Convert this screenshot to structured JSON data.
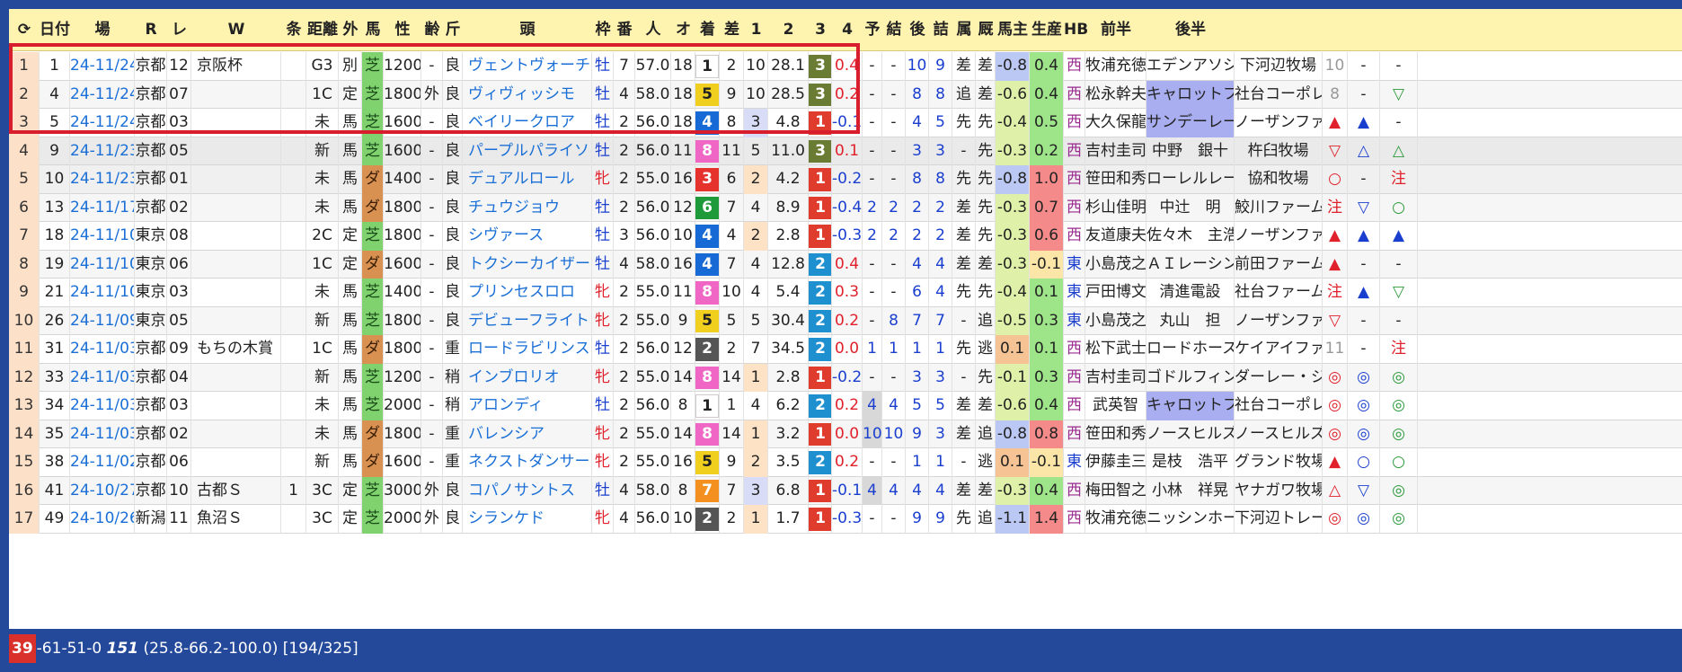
{
  "header": {
    "refresh_glyph": "⟳",
    "columns": [
      "日付",
      "場",
      "R",
      "レース名",
      "W",
      "条件",
      "距離",
      "外",
      "馬名",
      "性",
      "齢",
      "斤量",
      "頭",
      "枠",
      "番",
      "人",
      "オッズ",
      "着",
      "差",
      "1",
      "2",
      "3",
      "4",
      "予",
      "結",
      "後差",
      "詰脚",
      "属",
      "厩舎",
      "馬主",
      "生産",
      "HB",
      "前半",
      "後半"
    ]
  },
  "rows": [
    {
      "n": "1",
      "no": "1",
      "date": "24-11/24",
      "place": "京都",
      "r": "12",
      "race": "京阪杯",
      "w": "",
      "grade": "G3",
      "cond": "別",
      "surf": "芝",
      "dist": "1200",
      "out": "-",
      "going": "良",
      "horse": "ヴェントヴォーチェ",
      "sex": "牡",
      "age": "7",
      "kin": "57.0",
      "heads": "18",
      "waku": "1",
      "ban": "2",
      "pop": "10",
      "odds": "28.1",
      "chaku": "3",
      "sa": "0.4",
      "p1": "-",
      "p2": "-",
      "p3": "10",
      "p4": "9",
      "yo": "差",
      "ke": "差",
      "atosa": "-0.8",
      "tsume": "0.4",
      "zoku": "西",
      "stable": "牧浦充徳",
      "owner": "エデンアソシ",
      "breed": "下河辺牧場",
      "hb": "10",
      "zen": "-",
      "kou": "-"
    },
    {
      "n": "2",
      "no": "4",
      "date": "24-11/24",
      "place": "京都",
      "r": "07",
      "race": "",
      "w": "",
      "grade": "1C",
      "cond": "定",
      "surf": "芝",
      "dist": "1800",
      "out": "外",
      "going": "良",
      "horse": "ヴィヴィッシモ",
      "sex": "牡",
      "age": "4",
      "kin": "58.0",
      "heads": "18",
      "waku": "5",
      "ban": "9",
      "pop": "10",
      "odds": "28.5",
      "chaku": "3",
      "sa": "0.2",
      "p1": "-",
      "p2": "-",
      "p3": "8",
      "p4": "8",
      "yo": "追",
      "ke": "差",
      "atosa": "-0.6",
      "tsume": "0.4",
      "zoku": "西",
      "stable": "松永幹夫",
      "owner": "キャロットフ",
      "breed": "社台コーポレ",
      "hb": "8",
      "zen": "-",
      "kou": "▽"
    },
    {
      "n": "3",
      "no": "5",
      "date": "24-11/24",
      "place": "京都",
      "r": "03",
      "race": "",
      "w": "",
      "grade": "未",
      "cond": "馬",
      "surf": "芝",
      "dist": "1600",
      "out": "-",
      "going": "良",
      "horse": "ベイリークロア",
      "sex": "牡",
      "age": "2",
      "kin": "56.0",
      "heads": "18",
      "waku": "4",
      "ban": "8",
      "pop": "3",
      "odds": "4.8",
      "chaku": "1",
      "sa": "-0.1",
      "p1": "-",
      "p2": "-",
      "p3": "4",
      "p4": "5",
      "yo": "先",
      "ke": "先",
      "atosa": "-0.4",
      "tsume": "0.5",
      "zoku": "西",
      "stable": "大久保龍",
      "owner": "サンデーレー",
      "breed": "ノーザンファ",
      "hb": "▲",
      "zen": "▲",
      "kou": "-"
    },
    {
      "n": "4",
      "no": "9",
      "date": "24-11/23",
      "place": "京都",
      "r": "05",
      "race": "",
      "w": "",
      "grade": "新",
      "cond": "馬",
      "surf": "芝",
      "dist": "1600",
      "out": "-",
      "going": "良",
      "horse": "パープルパライソ",
      "sex": "牡",
      "age": "2",
      "kin": "56.0",
      "heads": "11",
      "waku": "8",
      "ban": "11",
      "pop": "5",
      "odds": "11.0",
      "chaku": "3",
      "sa": "0.1",
      "p1": "-",
      "p2": "-",
      "p3": "3",
      "p4": "3",
      "yo": "-",
      "ke": "先",
      "atosa": "-0.3",
      "tsume": "0.2",
      "zoku": "西",
      "stable": "吉村圭司",
      "owner": "中野　銀十",
      "breed": "杵臼牧場",
      "hb": "▽",
      "zen": "△",
      "kou": "△"
    },
    {
      "n": "5",
      "no": "10",
      "date": "24-11/23",
      "place": "京都",
      "r": "01",
      "race": "",
      "w": "",
      "grade": "未",
      "cond": "馬",
      "surf": "ダ",
      "dist": "1400",
      "out": "-",
      "going": "良",
      "horse": "デュアルロール",
      "sex": "牝",
      "age": "2",
      "kin": "55.0",
      "heads": "16",
      "waku": "3",
      "ban": "6",
      "pop": "2",
      "odds": "4.2",
      "chaku": "1",
      "sa": "-0.2",
      "p1": "-",
      "p2": "-",
      "p3": "8",
      "p4": "8",
      "yo": "先",
      "ke": "先",
      "atosa": "-0.8",
      "tsume": "1.0",
      "zoku": "西",
      "stable": "笹田和秀",
      "owner": "ローレルレー",
      "breed": "協和牧場",
      "hb": "○",
      "zen": "-",
      "kou": "注"
    },
    {
      "n": "6",
      "no": "13",
      "date": "24-11/17",
      "place": "京都",
      "r": "02",
      "race": "",
      "w": "",
      "grade": "未",
      "cond": "馬",
      "surf": "ダ",
      "dist": "1800",
      "out": "-",
      "going": "良",
      "horse": "チュウジョウ",
      "sex": "牡",
      "age": "2",
      "kin": "56.0",
      "heads": "12",
      "waku": "6",
      "ban": "7",
      "pop": "4",
      "odds": "8.9",
      "chaku": "1",
      "sa": "-0.4",
      "p1": "2",
      "p2": "2",
      "p3": "2",
      "p4": "2",
      "yo": "差",
      "ke": "先",
      "atosa": "-0.3",
      "tsume": "0.7",
      "zoku": "西",
      "stable": "杉山佳明",
      "owner": "中辻　明",
      "breed": "鮫川ファーム",
      "hb": "注",
      "zen": "▽",
      "kou": "○"
    },
    {
      "n": "7",
      "no": "18",
      "date": "24-11/10",
      "place": "東京",
      "r": "08",
      "race": "",
      "w": "",
      "grade": "2C",
      "cond": "定",
      "surf": "芝",
      "dist": "1800",
      "out": "-",
      "going": "良",
      "horse": "シヴァース",
      "sex": "牡",
      "age": "3",
      "kin": "56.0",
      "heads": "10",
      "waku": "4",
      "ban": "4",
      "pop": "2",
      "odds": "2.8",
      "chaku": "1",
      "sa": "-0.3",
      "p1": "2",
      "p2": "2",
      "p3": "2",
      "p4": "2",
      "yo": "差",
      "ke": "先",
      "atosa": "-0.3",
      "tsume": "0.6",
      "zoku": "西",
      "stable": "友道康夫",
      "owner": "佐々木　主浩",
      "breed": "ノーザンファ",
      "hb": "▲",
      "zen": "▲",
      "kou": "▲"
    },
    {
      "n": "8",
      "no": "19",
      "date": "24-11/10",
      "place": "東京",
      "r": "06",
      "race": "",
      "w": "",
      "grade": "1C",
      "cond": "定",
      "surf": "ダ",
      "dist": "1600",
      "out": "-",
      "going": "良",
      "horse": "トクシーカイザー",
      "sex": "牡",
      "age": "4",
      "kin": "58.0",
      "heads": "16",
      "waku": "4",
      "ban": "7",
      "pop": "4",
      "odds": "12.8",
      "chaku": "2",
      "sa": "0.4",
      "p1": "-",
      "p2": "-",
      "p3": "4",
      "p4": "4",
      "yo": "差",
      "ke": "差",
      "atosa": "-0.3",
      "tsume": "-0.1",
      "zoku": "東",
      "stable": "小島茂之",
      "owner": "ＡＩレーシン",
      "breed": "前田ファーム",
      "hb": "▲",
      "zen": "-",
      "kou": "-"
    },
    {
      "n": "9",
      "no": "21",
      "date": "24-11/10",
      "place": "東京",
      "r": "03",
      "race": "",
      "w": "",
      "grade": "未",
      "cond": "馬",
      "surf": "芝",
      "dist": "1400",
      "out": "-",
      "going": "良",
      "horse": "プリンセスロロ",
      "sex": "牝",
      "age": "2",
      "kin": "55.0",
      "heads": "11",
      "waku": "8",
      "ban": "10",
      "pop": "4",
      "odds": "5.4",
      "chaku": "2",
      "sa": "0.3",
      "p1": "-",
      "p2": "-",
      "p3": "6",
      "p4": "4",
      "yo": "先",
      "ke": "先",
      "atosa": "-0.4",
      "tsume": "0.1",
      "zoku": "東",
      "stable": "戸田博文",
      "owner": "清進電設",
      "breed": "社台ファーム",
      "hb": "注",
      "zen": "▲",
      "kou": "▽"
    },
    {
      "n": "10",
      "no": "26",
      "date": "24-11/09",
      "place": "東京",
      "r": "05",
      "race": "",
      "w": "",
      "grade": "新",
      "cond": "馬",
      "surf": "芝",
      "dist": "1800",
      "out": "-",
      "going": "良",
      "horse": "デビューフライト",
      "sex": "牝",
      "age": "2",
      "kin": "55.0",
      "heads": "9",
      "waku": "5",
      "ban": "5",
      "pop": "5",
      "odds": "30.4",
      "chaku": "2",
      "sa": "0.2",
      "p1": "-",
      "p2": "8",
      "p3": "7",
      "p4": "7",
      "yo": "-",
      "ke": "追",
      "atosa": "-0.5",
      "tsume": "0.3",
      "zoku": "東",
      "stable": "小島茂之",
      "owner": "丸山　担",
      "breed": "ノーザンファ",
      "hb": "▽",
      "zen": "-",
      "kou": "-"
    },
    {
      "n": "11",
      "no": "31",
      "date": "24-11/03",
      "place": "京都",
      "r": "09",
      "race": "もちの木賞",
      "w": "",
      "grade": "1C",
      "cond": "馬",
      "surf": "ダ",
      "dist": "1800",
      "out": "-",
      "going": "重",
      "horse": "ロードラビリンス",
      "sex": "牡",
      "age": "2",
      "kin": "56.0",
      "heads": "12",
      "waku": "2",
      "ban": "2",
      "pop": "7",
      "odds": "34.5",
      "chaku": "2",
      "sa": "0.0",
      "p1": "1",
      "p2": "1",
      "p3": "1",
      "p4": "1",
      "yo": "先",
      "ke": "逃",
      "atosa": "0.1",
      "tsume": "0.1",
      "zoku": "西",
      "stable": "松下武士",
      "owner": "ロードホース",
      "breed": "ケイアイファ",
      "hb": "11",
      "zen": "-",
      "kou": "注"
    },
    {
      "n": "12",
      "no": "33",
      "date": "24-11/03",
      "place": "京都",
      "r": "04",
      "race": "",
      "w": "",
      "grade": "新",
      "cond": "馬",
      "surf": "芝",
      "dist": "1200",
      "out": "-",
      "going": "稍",
      "horse": "インブロリオ",
      "sex": "牝",
      "age": "2",
      "kin": "55.0",
      "heads": "14",
      "waku": "8",
      "ban": "14",
      "pop": "1",
      "odds": "2.8",
      "chaku": "1",
      "sa": "-0.2",
      "p1": "-",
      "p2": "-",
      "p3": "3",
      "p4": "3",
      "yo": "-",
      "ke": "先",
      "atosa": "-0.1",
      "tsume": "0.3",
      "zoku": "西",
      "stable": "吉村圭司",
      "owner": "ゴドルフィン",
      "breed": "ダーレー・ジ",
      "hb": "◎",
      "zen": "◎",
      "kou": "◎"
    },
    {
      "n": "13",
      "no": "34",
      "date": "24-11/03",
      "place": "京都",
      "r": "03",
      "race": "",
      "w": "",
      "grade": "未",
      "cond": "馬",
      "surf": "芝",
      "dist": "2000",
      "out": "-",
      "going": "稍",
      "horse": "アロンディ",
      "sex": "牡",
      "age": "2",
      "kin": "56.0",
      "heads": "8",
      "waku": "1",
      "ban": "1",
      "pop": "4",
      "odds": "6.2",
      "chaku": "2",
      "sa": "0.2",
      "p1": "4",
      "p2": "4",
      "p3": "5",
      "p4": "5",
      "yo": "差",
      "ke": "差",
      "atosa": "-0.6",
      "tsume": "0.4",
      "zoku": "西",
      "stable": "武英智",
      "owner": "キャロットフ",
      "breed": "社台コーポレ",
      "hb": "◎",
      "zen": "◎",
      "kou": "◎"
    },
    {
      "n": "14",
      "no": "35",
      "date": "24-11/03",
      "place": "京都",
      "r": "02",
      "race": "",
      "w": "",
      "grade": "未",
      "cond": "馬",
      "surf": "ダ",
      "dist": "1800",
      "out": "-",
      "going": "重",
      "horse": "バレンシア",
      "sex": "牝",
      "age": "2",
      "kin": "55.0",
      "heads": "14",
      "waku": "8",
      "ban": "14",
      "pop": "1",
      "odds": "3.2",
      "chaku": "1",
      "sa": "0.0",
      "p1": "10",
      "p2": "10",
      "p3": "9",
      "p4": "3",
      "yo": "差",
      "ke": "追",
      "atosa": "-0.8",
      "tsume": "0.8",
      "zoku": "西",
      "stable": "笹田和秀",
      "owner": "ノースヒルズ",
      "breed": "ノースヒルズ",
      "hb": "◎",
      "zen": "◎",
      "kou": "◎"
    },
    {
      "n": "15",
      "no": "38",
      "date": "24-11/02",
      "place": "京都",
      "r": "06",
      "race": "",
      "w": "",
      "grade": "新",
      "cond": "馬",
      "surf": "ダ",
      "dist": "1600",
      "out": "-",
      "going": "重",
      "horse": "ネクストダンサー",
      "sex": "牝",
      "age": "2",
      "kin": "55.0",
      "heads": "16",
      "waku": "5",
      "ban": "9",
      "pop": "2",
      "odds": "3.5",
      "chaku": "2",
      "sa": "0.2",
      "p1": "-",
      "p2": "-",
      "p3": "1",
      "p4": "1",
      "yo": "-",
      "ke": "逃",
      "atosa": "0.1",
      "tsume": "-0.1",
      "zoku": "東",
      "stable": "伊藤圭三",
      "owner": "是枝　浩平",
      "breed": "グランド牧場",
      "hb": "▲",
      "zen": "○",
      "kou": "○"
    },
    {
      "n": "16",
      "no": "41",
      "date": "24-10/27",
      "place": "京都",
      "r": "10",
      "race": "古都Ｓ",
      "w": "1",
      "grade": "3C",
      "cond": "定",
      "surf": "芝",
      "dist": "3000",
      "out": "外",
      "going": "良",
      "horse": "コパノサントス",
      "sex": "牡",
      "age": "4",
      "kin": "58.0",
      "heads": "8",
      "waku": "7",
      "ban": "7",
      "pop": "3",
      "odds": "6.8",
      "chaku": "1",
      "sa": "-0.1",
      "p1": "4",
      "p2": "4",
      "p3": "4",
      "p4": "4",
      "yo": "差",
      "ke": "差",
      "atosa": "-0.3",
      "tsume": "0.4",
      "zoku": "西",
      "stable": "梅田智之",
      "owner": "小林　祥晃",
      "breed": "ヤナガワ牧場",
      "hb": "△",
      "zen": "▽",
      "kou": "◎"
    },
    {
      "n": "17",
      "no": "49",
      "date": "24-10/26",
      "place": "新潟",
      "r": "11",
      "race": "魚沼Ｓ",
      "w": "",
      "grade": "3C",
      "cond": "定",
      "surf": "芝",
      "dist": "2000",
      "out": "外",
      "going": "良",
      "horse": "シランケド",
      "sex": "牝",
      "age": "4",
      "kin": "56.0",
      "heads": "10",
      "waku": "2",
      "ban": "2",
      "pop": "1",
      "odds": "1.7",
      "chaku": "1",
      "sa": "-0.3",
      "p1": "-",
      "p2": "-",
      "p3": "9",
      "p4": "9",
      "yo": "先",
      "ke": "追",
      "atosa": "-1.1",
      "tsume": "1.4",
      "zoku": "西",
      "stable": "牧浦充徳",
      "owner": "ニッシンホー",
      "breed": "下河辺トレー",
      "hb": "◎",
      "zen": "◎",
      "kou": "◎"
    }
  ],
  "status": {
    "count": "39",
    "rest": "-61-51-0",
    "total": "151",
    "rates": "(25.8-66.2-100.0)",
    "pages": "[194/325]"
  },
  "colors": {
    "waku": {
      "1": "#ffffff",
      "2": "#555555",
      "3": "#e6322d",
      "4": "#1769d6",
      "5": "#f0cf1e",
      "6": "#1f9a3b",
      "7": "#f39020",
      "8": "#ef66c4"
    },
    "win1": "#e03c2e",
    "win2": "#1e8fcf",
    "win3": "#6a7c33",
    "highlight": "#d81e2c"
  }
}
